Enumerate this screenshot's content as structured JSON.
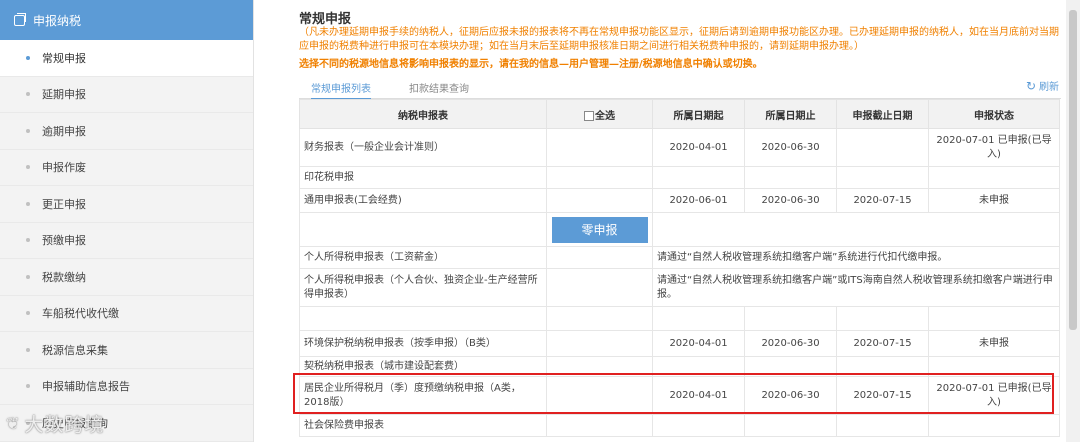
{
  "sidebar": {
    "header": "申报纳税",
    "items": [
      {
        "label": "常规申报",
        "active": true
      },
      {
        "label": "延期申报"
      },
      {
        "label": "逾期申报"
      },
      {
        "label": "申报作废"
      },
      {
        "label": "更正申报"
      },
      {
        "label": "预缴申报"
      },
      {
        "label": "税款缴纳"
      },
      {
        "label": "车船税代收代缴"
      },
      {
        "label": "税源信息采集"
      },
      {
        "label": "申报辅助信息报告"
      },
      {
        "label": "历史申报查询"
      }
    ]
  },
  "watermark": "大数跨境",
  "main": {
    "title": "常规申报",
    "notice": "（凡未办理延期申报手续的纳税人，征期后应报未报的报表将不再在常规申报功能区显示，征期后请到逾期申报功能区办理。已办理延期申报的纳税人，如在当月底前对当期应申报的税费种进行申报可在本模块办理；如在当月末后至延期申报核准日期之间进行相关税费种申报的，请到延期申报办理。）",
    "notice2": "选择不同的税源地信息将影响申报表的显示，请在我的信息—用户管理—注册/税源地信息中确认或切换。",
    "tabs": [
      "常规申报列表",
      "扣款结果查询"
    ],
    "refresh": "刷新",
    "zero_button": "零申报",
    "table": {
      "headers": [
        "纳税申报表",
        "全选",
        "所属日期起",
        "所属日期止",
        "申报截止日期",
        "申报状态"
      ],
      "rows": [
        {
          "name": "财务报表（一般企业会计准则）",
          "start": "2020-04-01",
          "end": "2020-06-30",
          "deadline": "",
          "status": "2020-07-01 已申报(已导入)"
        },
        {
          "name": "印花税申报",
          "start": "",
          "end": "",
          "deadline": "",
          "status": ""
        },
        {
          "name": "通用申报表(工会经费)",
          "start": "2020-06-01",
          "end": "2020-06-30",
          "deadline": "2020-07-15",
          "status": "未申报"
        },
        {
          "name": "个人所得税申报表（工资薪金）",
          "note": "请通过“自然人税收管理系统扣缴客户端”系统进行代扣代缴申报。"
        },
        {
          "name": "个人所得税申报表（个人合伙、独资企业-生产经营所得申报表）",
          "note": "请通过“自然人税收管理系统扣缴客户端”或ITS海南自然人税收管理系统扣缴客户端进行申报。"
        },
        {
          "name": "",
          "start": "",
          "end": "",
          "deadline": "",
          "status": ""
        },
        {
          "name": "环境保护税纳税申报表（按季申报）（B类）",
          "start": "2020-04-01",
          "end": "2020-06-30",
          "deadline": "2020-07-15",
          "status": "未申报"
        },
        {
          "name": "契税纳税申报表（城市建设配套费）",
          "start": "",
          "end": "",
          "deadline": "",
          "status": ""
        },
        {
          "name": "居民企业所得税月（季）度预缴纳税申报（A类，2018版）",
          "start": "2020-04-01",
          "end": "2020-06-30",
          "deadline": "2020-07-15",
          "status": "2020-07-01 已申报(已导入)"
        },
        {
          "name": "社会保险费申报表",
          "start": "",
          "end": "",
          "deadline": "",
          "status": ""
        }
      ]
    }
  },
  "colors": {
    "accent": "#5c9bd6",
    "notice": "#f08000",
    "highlight": "#e02020"
  }
}
